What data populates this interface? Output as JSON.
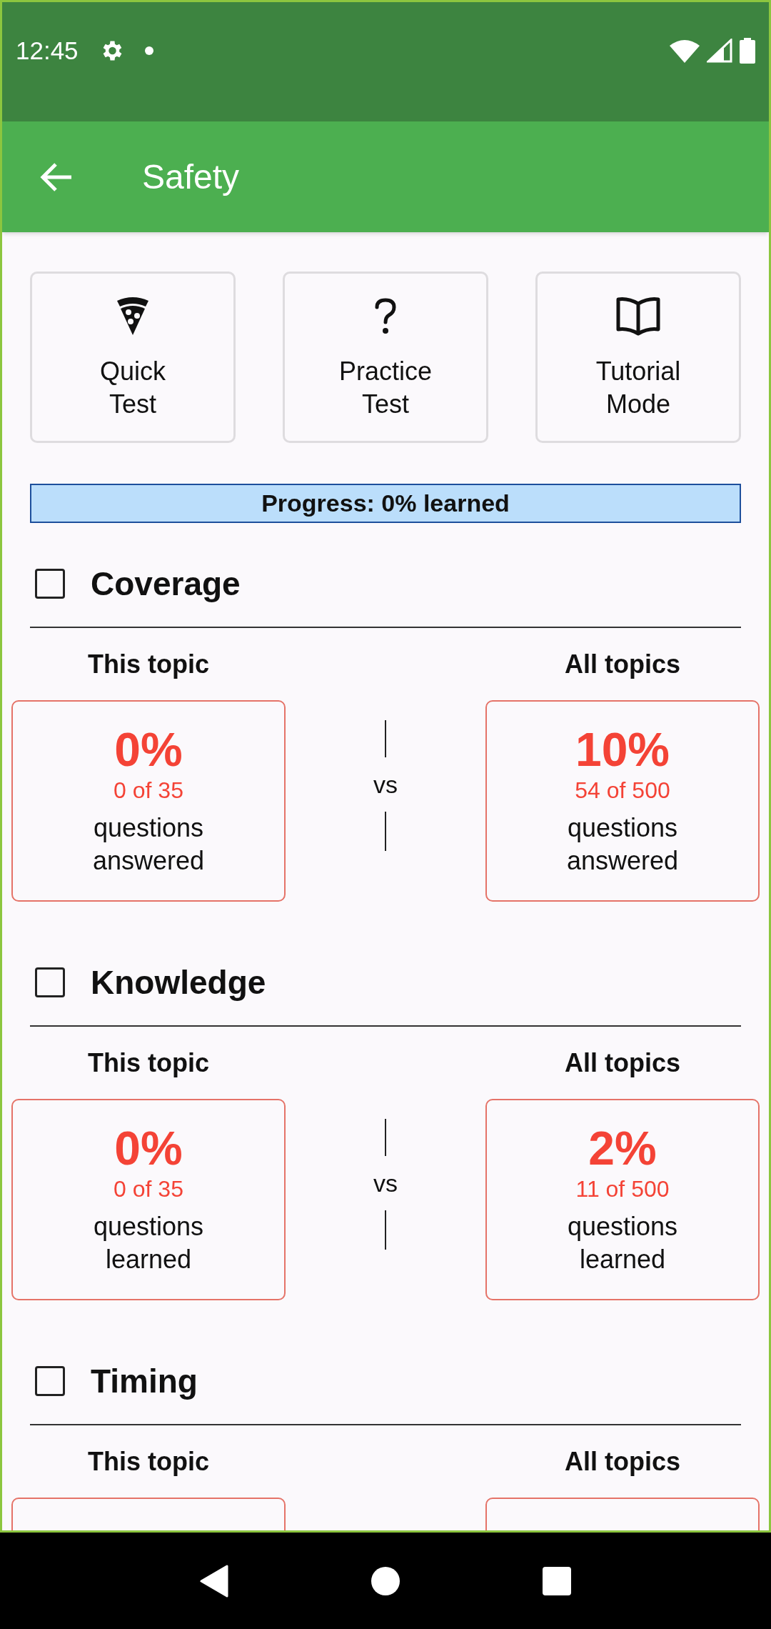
{
  "status_bar": {
    "time": "12:45"
  },
  "app_bar": {
    "title": "Safety"
  },
  "actions": [
    {
      "kind": "pizza",
      "label": "Quick\nTest"
    },
    {
      "kind": "question",
      "label": "Practice\nTest"
    },
    {
      "kind": "book",
      "label": "Tutorial\nMode"
    }
  ],
  "progress": {
    "label": "Progress: 0% learned"
  },
  "sections": [
    {
      "title": "Coverage",
      "checked": false,
      "separator": "vs",
      "comparisons": [
        {
          "heading": "This topic",
          "percent": "0%",
          "count": "0 of 35",
          "caption": "questions\nanswered"
        },
        {
          "heading": "All topics",
          "percent": "10%",
          "count": "54 of 500",
          "caption": "questions\nanswered"
        }
      ]
    },
    {
      "title": "Knowledge",
      "checked": false,
      "separator": "vs",
      "comparisons": [
        {
          "heading": "This topic",
          "percent": "0%",
          "count": "0 of 35",
          "caption": "questions\nlearned"
        },
        {
          "heading": "All topics",
          "percent": "2%",
          "count": "11 of 500",
          "caption": "questions\nlearned"
        }
      ]
    },
    {
      "title": "Timing",
      "checked": false,
      "comparisons": [
        {
          "heading": "This topic"
        },
        {
          "heading": "All topics"
        }
      ]
    }
  ]
}
